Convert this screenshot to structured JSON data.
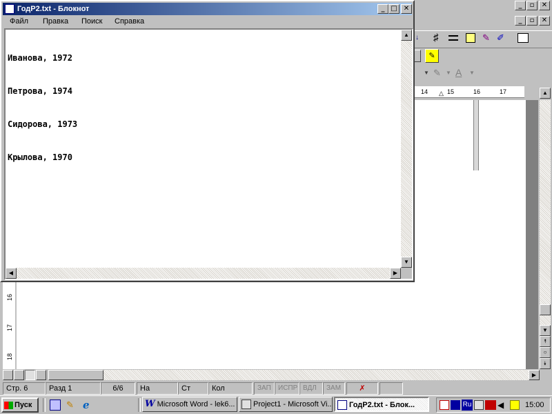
{
  "word": {
    "ruler_numbers": [
      "14",
      "15",
      "16",
      "17"
    ],
    "vruler_numbers": [
      "16",
      "17",
      "18"
    ],
    "status": {
      "page": "Стр. 6",
      "section": "Разд 1",
      "pages": "6/6",
      "at": "На",
      "line": "Ст",
      "col": "Кол",
      "rec": "ЗАП",
      "trk": "ИСПР",
      "ext": "ВДЛ",
      "ovr": "ЗАМ"
    }
  },
  "notepad": {
    "title": "ГодР2.txt - Блокнот",
    "menu": [
      "Файл",
      "Правка",
      "Поиск",
      "Справка"
    ],
    "lines": [
      "Иванова, 1972",
      "Петрова, 1974",
      "Сидорова, 1973",
      "Крылова, 1970"
    ]
  },
  "taskbar": {
    "start": "Пуск",
    "tasks": [
      "Microsoft Word - lek6...",
      "Project1 - Microsoft Vi...",
      "ГодР2.txt - Блок..."
    ],
    "lang": "Ru",
    "clock": "15:00"
  },
  "colors": {
    "title_active": "#0a246a",
    "title_gradient": "#a6caf0",
    "desktop": "#c0c0c0"
  }
}
